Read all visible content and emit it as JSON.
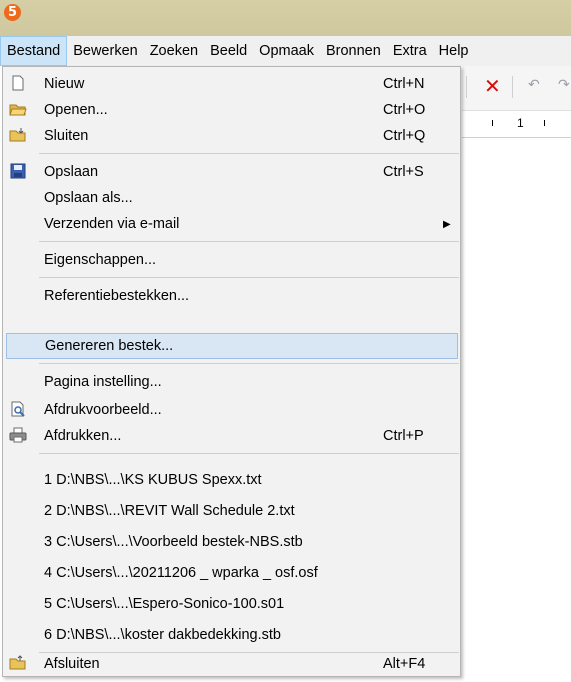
{
  "app": {
    "logo_text": "5"
  },
  "menubar": {
    "items": [
      "Bestand",
      "Bewerken",
      "Zoeken",
      "Beeld",
      "Opmaak",
      "Bronnen",
      "Extra",
      "Help"
    ]
  },
  "ruler": {
    "label": "1"
  },
  "file_menu": {
    "items": [
      {
        "label": "Nieuw",
        "shortcut": "Ctrl+N",
        "icon": "new-file-icon"
      },
      {
        "label": "Openen...",
        "shortcut": "Ctrl+O",
        "icon": "open-folder-icon"
      },
      {
        "label": "Sluiten",
        "shortcut": "Ctrl+Q",
        "icon": "close-folder-icon"
      },
      {
        "label": "Opslaan",
        "shortcut": "Ctrl+S",
        "icon": "save-icon"
      },
      {
        "label": "Opslaan als...",
        "shortcut": ""
      },
      {
        "label": "Verzenden via e-mail",
        "shortcut": "",
        "submenu": true
      },
      {
        "label": "Eigenschappen...",
        "shortcut": ""
      },
      {
        "label": "Referentiebestekken...",
        "shortcut": ""
      },
      {
        "label": "Genereren bestek...",
        "shortcut": "",
        "highlighted": true
      },
      {
        "label": "Pagina instelling...",
        "shortcut": ""
      },
      {
        "label": "Afdrukvoorbeeld...",
        "shortcut": "",
        "icon": "print-preview-icon"
      },
      {
        "label": "Afdrukken...",
        "shortcut": "Ctrl+P",
        "icon": "printer-icon"
      },
      {
        "label": "1 D:\\NBS\\...\\KS KUBUS Spexx.txt",
        "shortcut": ""
      },
      {
        "label": "2 D:\\NBS\\...\\REVIT Wall Schedule 2.txt",
        "shortcut": ""
      },
      {
        "label": "3 C:\\Users\\...\\Voorbeeld bestek-NBS.stb",
        "shortcut": ""
      },
      {
        "label": "4 C:\\Users\\...\\20211206 _ wparka _ osf.osf",
        "shortcut": ""
      },
      {
        "label": "5 C:\\Users\\...\\Espero-Sonico-100.s01",
        "shortcut": ""
      },
      {
        "label": "6 D:\\NBS\\...\\koster dakbedekking.stb",
        "shortcut": ""
      },
      {
        "label": "Afsluiten",
        "shortcut": "Alt+F4",
        "icon": "exit-icon"
      }
    ]
  },
  "colors": {
    "highlight": "#d9e7f5",
    "title_bar": "#d2cba2",
    "logo": "#ee6a1a",
    "delete_icon": "#d01010"
  }
}
